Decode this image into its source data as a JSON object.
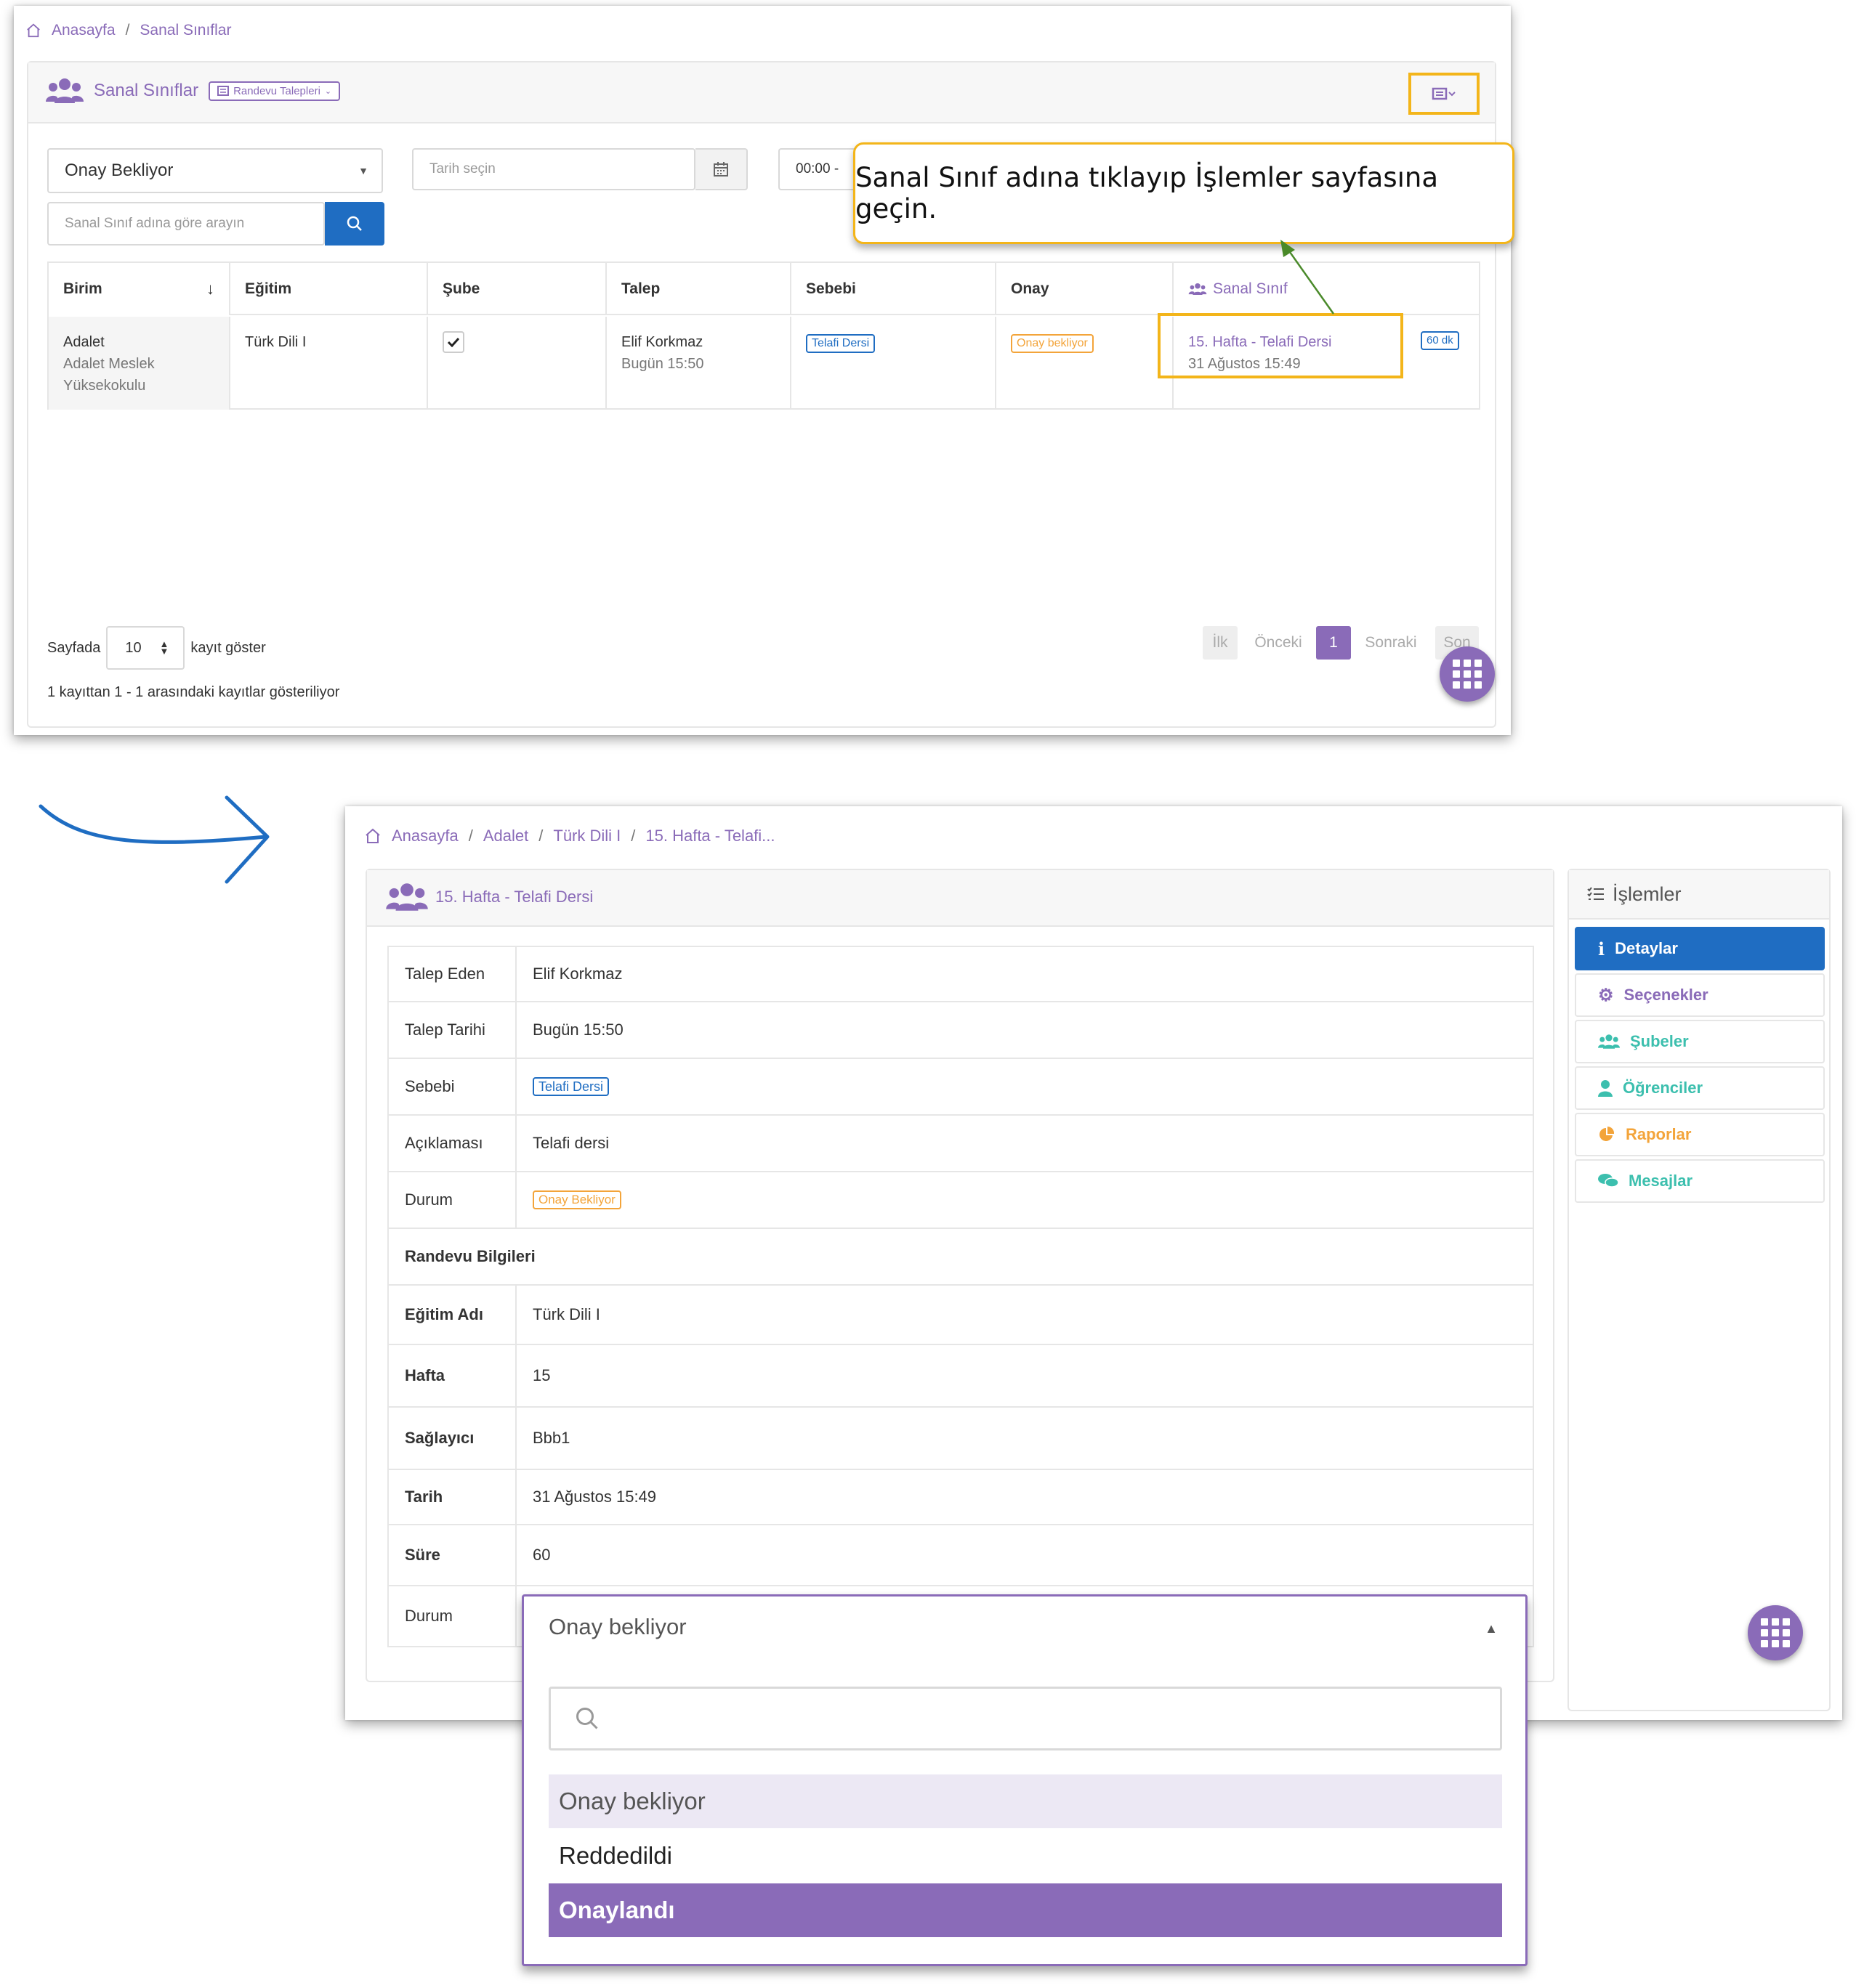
{
  "top": {
    "breadcrumb": [
      "Anasayfa",
      "Sanal Sınıflar"
    ],
    "card_title": "Sanal Sınıflar",
    "dropdown_chip": "Randevu Talepleri",
    "status_select": "Onay Bekliyor",
    "date_placeholder": "Tarih seçin",
    "time_value": "00:00 -",
    "search_placeholder": "Sanal Sınıf adına göre arayın",
    "tooltip": "Sanal Sınıf adına tıklayıp İşlemler sayfasına geçin.",
    "columns": [
      "Birim",
      "Eğitim",
      "Şube",
      "Talep",
      "Sebebi",
      "Onay",
      "Sanal Sınıf"
    ],
    "row": {
      "birim": "Adalet",
      "birim_sub1": "Adalet Meslek",
      "birim_sub2": "Yüksekokulu",
      "egitim": "Türk Dili I",
      "talep_name": "Elif Korkmaz",
      "talep_time": "Bugün 15:50",
      "sebebi": "Telafi Dersi",
      "onay": "Onay bekliyor",
      "sanal_sinif_title": "15. Hafta - Telafi Dersi",
      "sanal_sinif_date": "31 Ağustos 15:49",
      "duration": "60 dk"
    },
    "footer": {
      "per_page_label": "Sayfada",
      "per_page_value": "10",
      "per_page_suffix": "kayıt göster",
      "summary": "1 kayıttan 1 - 1 arasındaki kayıtlar gösteriliyor"
    },
    "pager": [
      "İlk",
      "Önceki",
      "1",
      "Sonraki",
      "Son"
    ]
  },
  "bottom": {
    "breadcrumb": [
      "Anasayfa",
      "Adalet",
      "Türk Dili I",
      "15. Hafta - Telafi..."
    ],
    "card_title": "15. Hafta - Telafi Dersi",
    "details": {
      "talep_eden_label": "Talep Eden",
      "talep_eden": "Elif Korkmaz",
      "talep_tarihi_label": "Talep Tarihi",
      "talep_tarihi": "Bugün 15:50",
      "sebebi_label": "Sebebi",
      "sebebi": "Telafi Dersi",
      "aciklama_label": "Açıklaması",
      "aciklama": "Telafi dersi",
      "durum_label": "Durum",
      "durum": "Onay Bekliyor",
      "section_title": "Randevu Bilgileri",
      "egitim_adi_label": "Eğitim Adı",
      "egitim_adi": "Türk Dili I",
      "hafta_label": "Hafta",
      "hafta": "15",
      "saglayici_label": "Sağlayıcı",
      "saglayici": "Bbb1",
      "tarih_label": "Tarih",
      "tarih": "31 Ağustos 15:49",
      "sure_label": "Süre",
      "sure": "60",
      "durum2_label": "Durum"
    },
    "side": {
      "title": "İşlemler",
      "items": [
        "Detaylar",
        "Seçenekler",
        "Şubeler",
        "Öğrenciler",
        "Raporlar",
        "Mesajlar"
      ]
    },
    "dropdown": {
      "selected": "Onay bekliyor",
      "options": [
        "Onay bekliyor",
        "Reddedildi",
        "Onaylandı"
      ]
    }
  },
  "colors": {
    "brand_purple": "#8a6bb8",
    "primary_blue": "#1f6dc2",
    "highlight_yellow": "#f3b51a",
    "warning_orange": "#f3a43a",
    "teal": "#3cbfae"
  }
}
